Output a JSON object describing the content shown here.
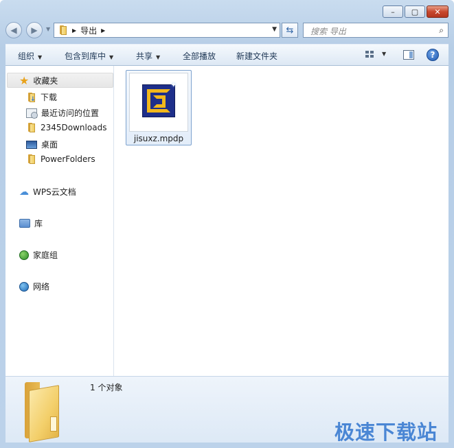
{
  "window": {
    "buttons": {
      "minimize": "–",
      "maximize": "▢",
      "close": "✕"
    }
  },
  "nav": {
    "back_icon": "back-arrow-icon",
    "forward_icon": "forward-arrow-icon",
    "address": {
      "segments": [
        "导出"
      ]
    },
    "search_placeholder": "搜索 导出"
  },
  "toolbar": {
    "organize": "组织",
    "include_in_library": "包含到库中",
    "share": "共享",
    "play_all": "全部播放",
    "new_folder": "新建文件夹"
  },
  "sidebar": {
    "favorites_label": "收藏夹",
    "favorites": [
      {
        "label": "下载",
        "icon": "download-folder-icon"
      },
      {
        "label": "最近访问的位置",
        "icon": "recent-places-icon"
      },
      {
        "label": "2345Downloads",
        "icon": "folder-icon"
      },
      {
        "label": "桌面",
        "icon": "desktop-icon"
      },
      {
        "label": "PowerFolders",
        "icon": "folder-icon"
      }
    ],
    "wps_cloud": "WPS云文档",
    "libraries": "库",
    "homegroup": "家庭组",
    "network": "网络"
  },
  "files": [
    {
      "name": "jisuxz.mpdp",
      "icon": "mp-file-icon"
    }
  ],
  "status": {
    "count_text": "1 个对象"
  },
  "watermark": "极速下载站",
  "colors": {
    "accent": "#4a86d4",
    "close_red": "#c8482e",
    "folder_yellow": "#f0cc5e"
  }
}
